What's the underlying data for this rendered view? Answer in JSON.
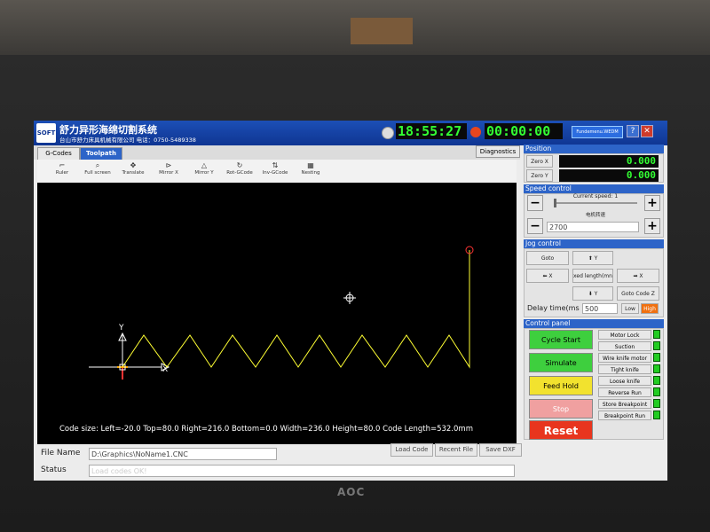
{
  "app": {
    "logo_text": "SOFT",
    "title": "舒力异形海绵切割系统",
    "subtitle": "台山市舒力床具机械有限公司 电话：0750-5489338",
    "clock": "18:55:27",
    "elapsed": "00:00:00",
    "web_label": "Fundemenu.WEDM",
    "help_label": "?",
    "close_label": "✕"
  },
  "tabs": [
    {
      "label": "G-Codes",
      "active": false
    },
    {
      "label": "Toolpath",
      "active": true
    }
  ],
  "diagnostics_label": "Diagnostics",
  "toolbar": [
    {
      "icon": "ruler-icon",
      "glyph": "⌐",
      "label": "Ruler"
    },
    {
      "icon": "zoom-icon",
      "glyph": "⌕",
      "label": "Full screen"
    },
    {
      "icon": "move-icon",
      "glyph": "✥",
      "label": "Translate"
    },
    {
      "icon": "mirror-x-icon",
      "glyph": "⊳",
      "label": "Mirror X"
    },
    {
      "icon": "mirror-y-icon",
      "glyph": "△",
      "label": "Mirror Y"
    },
    {
      "icon": "rotate-icon",
      "glyph": "↻",
      "label": "Rot-GCode"
    },
    {
      "icon": "invert-icon",
      "glyph": "⇅",
      "label": "Inv-GCode"
    },
    {
      "icon": "nesting-icon",
      "glyph": "▦",
      "label": "Nesting"
    }
  ],
  "canvas": {
    "axis_y": "Y",
    "axis_x": "X",
    "code_size_text": "Code size:  Left=-20.0  Top=80.0  Right=216.0  Bottom=0.0  Width=236.0  Height=80.0  Code Length=532.0mm"
  },
  "file": {
    "name_label": "File Name",
    "name_value": "D:\\Graphics\\NoName1.CNC",
    "status_label": "Status",
    "status_value": "Load codes OK!",
    "load_code": "Load Code",
    "recent_file": "Recent File",
    "save_dxf": "Save DXF"
  },
  "position": {
    "header": "Position",
    "zero_x": "Zero X",
    "zero_y": "Zero Y",
    "x_value": "0.000",
    "y_value": "0.000"
  },
  "speed": {
    "header": "Speed control",
    "current_label": "Current speed: 1",
    "motor_label": "电机转速",
    "motor_value": "2700",
    "minus": "−",
    "plus": "+"
  },
  "jog": {
    "header": "Jog control",
    "goto_breakpoint": "Goto Breakpoint",
    "plus_y": "⬆ Y",
    "minus_x": "⬅ X",
    "fixed_length": "xed length(mn",
    "plus_x": "➡ X",
    "minus_y": "⬇ Y",
    "goto_code_z": "Goto Code Z",
    "delay_label": "Delay time(ms",
    "delay_value": "500",
    "low": "Low",
    "high": "High"
  },
  "control": {
    "header": "Control panel",
    "cycle_start": "Cycle Start",
    "simulate": "Simulate",
    "feed_hold": "Feed Hold",
    "stop": "Stop",
    "reset": "Reset",
    "switches": [
      "Motor Lock",
      "Suction",
      "Wire knife motor",
      "Tight knife",
      "Loose knife",
      "Reverse Run",
      "Store Breakpoint",
      "Breakpoint Run"
    ]
  },
  "monitor_brand": "AOC"
}
